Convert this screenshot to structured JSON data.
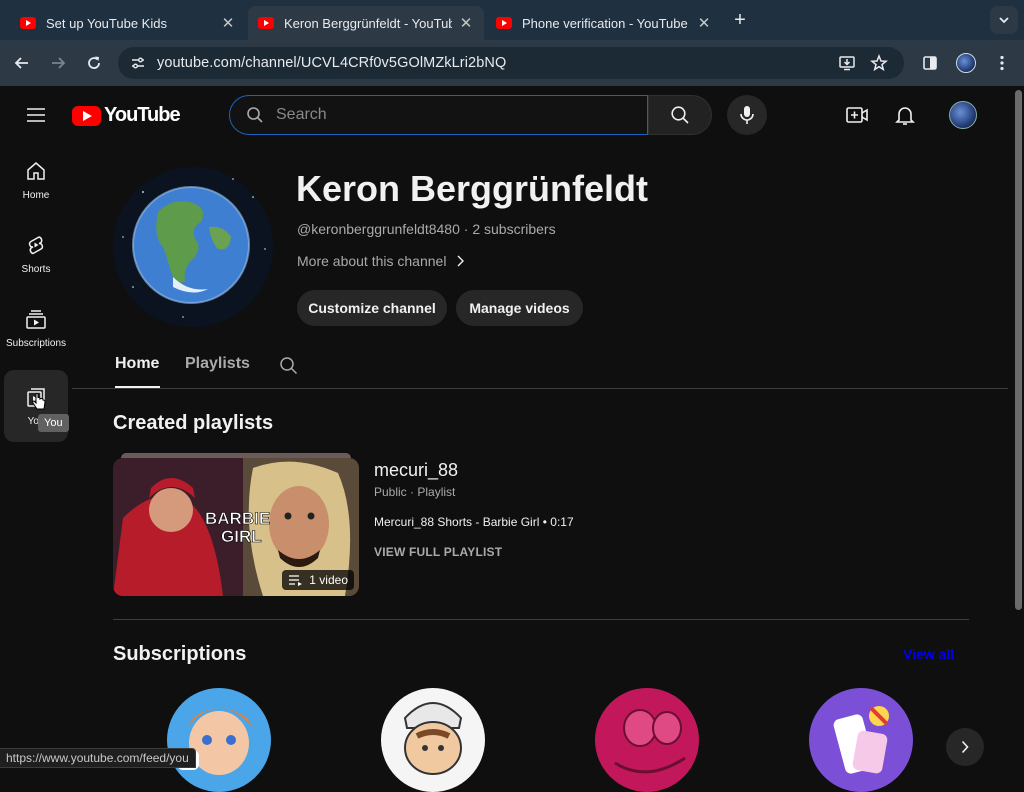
{
  "browser": {
    "tabs": [
      {
        "title": "Set up YouTube Kids",
        "active": false
      },
      {
        "title": "Keron Berggrünfeldt - YouTube",
        "active": true
      },
      {
        "title": "Phone verification - YouTube",
        "active": false
      }
    ],
    "url": "youtube.com/channel/UCVL4CRf0v5GOlMZkLri2bNQ",
    "status_url": "https://www.youtube.com/feed/you"
  },
  "header": {
    "logo_text": "YouTube",
    "search_placeholder": "Search"
  },
  "sidebar": {
    "items": [
      {
        "label": "Home",
        "icon": "home-icon"
      },
      {
        "label": "Shorts",
        "icon": "shorts-icon"
      },
      {
        "label": "Subscriptions",
        "icon": "subscriptions-icon"
      },
      {
        "label": "You",
        "icon": "you-icon"
      }
    ],
    "tooltip": "You"
  },
  "channel": {
    "name": "Keron Berggrünfeldt",
    "handle": "@keronberggrunfeldt8480",
    "subscribers": "2 subscribers",
    "more_label": "More about this channel",
    "customize_label": "Customize channel",
    "manage_label": "Manage videos",
    "tabs": [
      "Home",
      "Playlists"
    ]
  },
  "created_playlists": {
    "title": "Created playlists",
    "playlist": {
      "name": "mecuri_88",
      "visibility": "Public · Playlist",
      "first_item": "Mercuri_88 Shorts - Barbie Girl",
      "first_item_duration": "0:17",
      "view_full": "VIEW FULL PLAYLIST",
      "video_count": "1 video",
      "thumb_text": "BARBIE GIRL"
    }
  },
  "subscriptions": {
    "title": "Subscriptions",
    "view_all": "View all"
  },
  "colors": {
    "brand_red": "#ff0000",
    "background": "#0f0f0f",
    "link": "#0000ee"
  }
}
